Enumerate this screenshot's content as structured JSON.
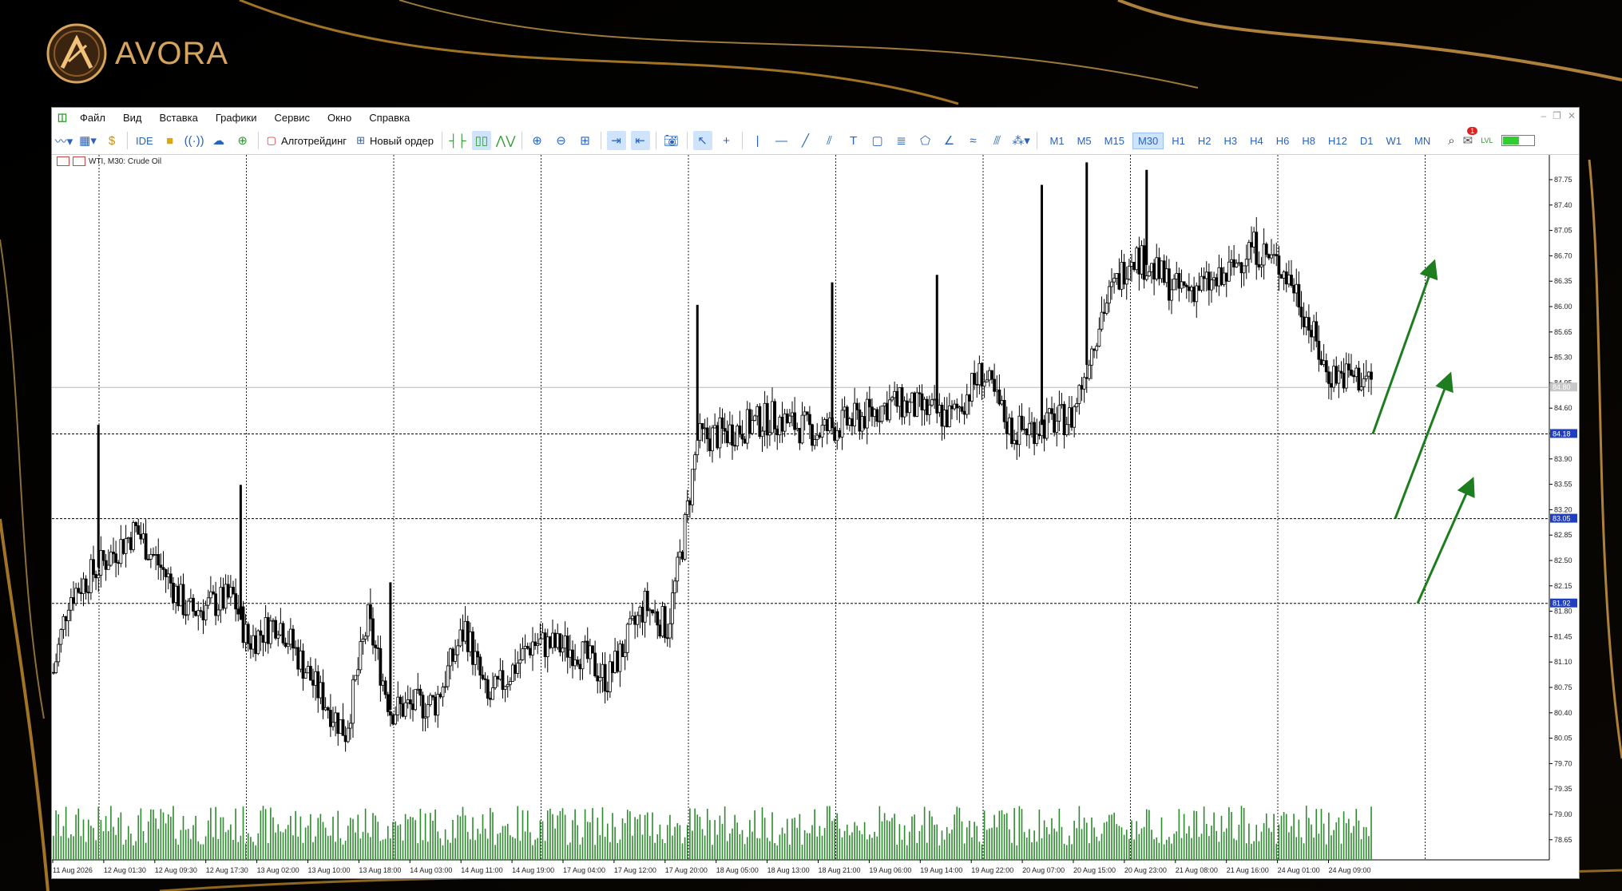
{
  "brand": {
    "name": "AVORA",
    "colors": {
      "gold": "#d6a45c"
    }
  },
  "menu": {
    "items": [
      "Файл",
      "Вид",
      "Вставка",
      "Графики",
      "Сервис",
      "Окно",
      "Справка"
    ]
  },
  "toolbar": {
    "ide_label": "IDE",
    "algotrading_label": "Алготрейдинг",
    "new_order_label": "Новый ордер",
    "timeframes": [
      "M1",
      "M5",
      "M15",
      "M30",
      "H1",
      "H2",
      "H3",
      "H4",
      "H6",
      "H8",
      "H12",
      "D1",
      "W1",
      "MN"
    ],
    "active_timeframe": "M30",
    "notification_count": "1",
    "lvl_label": "LVL"
  },
  "chart": {
    "symbol_info": "WTI, M30:  Crude Oil",
    "price_labels": [
      "87.75",
      "87.40",
      "87.05",
      "86.70",
      "86.35",
      "86.00",
      "85.65",
      "85.30",
      "84.95",
      "84.60",
      "84.25",
      "83.90",
      "83.55",
      "83.20",
      "82.85",
      "82.50",
      "82.15",
      "81.80",
      "81.45",
      "81.10",
      "80.75",
      "80.40",
      "80.05",
      "79.70",
      "79.35",
      "79.00",
      "78.65"
    ],
    "time_labels": [
      "11 Aug 2026",
      "12 Aug 01:30",
      "12 Aug 09:30",
      "12 Aug 17:30",
      "13 Aug 02:00",
      "13 Aug 10:00",
      "13 Aug 18:00",
      "14 Aug 03:00",
      "14 Aug 11:00",
      "14 Aug 19:00",
      "17 Aug 04:00",
      "17 Aug 12:00",
      "17 Aug 20:00",
      "18 Aug 05:00",
      "18 Aug 13:00",
      "18 Aug 21:00",
      "19 Aug 06:00",
      "19 Aug 14:00",
      "19 Aug 22:00",
      "20 Aug 07:00",
      "20 Aug 15:00",
      "20 Aug 23:00",
      "21 Aug 08:00",
      "21 Aug 16:00",
      "24 Aug 01:00",
      "24 Aug 09:00"
    ],
    "levels": [
      {
        "price": 84.18,
        "label": "84.18"
      },
      {
        "price": 83.05,
        "label": "83.05"
      },
      {
        "price": 81.92,
        "label": "81.92"
      }
    ],
    "current_price": {
      "price": 84.8,
      "label": "84.80"
    },
    "colors": {
      "level_tag": "#1f3fbf",
      "arrow": "#1e7d1e",
      "volume": "#2e8b2e",
      "candle": "#000000",
      "grid": "#000000"
    }
  },
  "chart_data": {
    "type": "candlestick",
    "symbol": "WTI",
    "timeframe": "M30",
    "ylim": [
      78.5,
      87.9
    ],
    "price_path_keypoints": [
      {
        "t": 0,
        "p": 81.0
      },
      {
        "t": 2,
        "p": 82.0
      },
      {
        "t": 8,
        "p": 82.6
      },
      {
        "t": 11,
        "p": 82.9
      },
      {
        "t": 15,
        "p": 82.3
      },
      {
        "t": 18,
        "p": 81.8
      },
      {
        "t": 24,
        "p": 82.0
      },
      {
        "t": 26,
        "p": 81.4
      },
      {
        "t": 30,
        "p": 81.7
      },
      {
        "t": 35,
        "p": 80.8
      },
      {
        "t": 39,
        "p": 80.2
      },
      {
        "t": 42,
        "p": 81.7
      },
      {
        "t": 45,
        "p": 80.5
      },
      {
        "t": 51,
        "p": 80.6
      },
      {
        "t": 55,
        "p": 81.6
      },
      {
        "t": 58,
        "p": 80.6
      },
      {
        "t": 64,
        "p": 81.4
      },
      {
        "t": 70,
        "p": 81.3
      },
      {
        "t": 74,
        "p": 80.9
      },
      {
        "t": 79,
        "p": 81.9
      },
      {
        "t": 82,
        "p": 81.6
      },
      {
        "t": 84,
        "p": 82.7
      },
      {
        "t": 86,
        "p": 84.1
      },
      {
        "t": 90,
        "p": 84.2
      },
      {
        "t": 96,
        "p": 84.4
      },
      {
        "t": 102,
        "p": 84.2
      },
      {
        "t": 108,
        "p": 84.4
      },
      {
        "t": 112,
        "p": 84.6
      },
      {
        "t": 120,
        "p": 84.4
      },
      {
        "t": 124,
        "p": 85.0
      },
      {
        "t": 128,
        "p": 84.2
      },
      {
        "t": 132,
        "p": 84.3
      },
      {
        "t": 136,
        "p": 84.4
      },
      {
        "t": 140,
        "p": 85.8
      },
      {
        "t": 144,
        "p": 86.6
      },
      {
        "t": 150,
        "p": 86.1
      },
      {
        "t": 156,
        "p": 86.2
      },
      {
        "t": 160,
        "p": 86.7
      },
      {
        "t": 164,
        "p": 86.4
      },
      {
        "t": 166,
        "p": 86.1
      },
      {
        "t": 170,
        "p": 85.0
      },
      {
        "t": 176,
        "p": 84.9
      }
    ],
    "spike_highs": [
      {
        "t": 6,
        "h": 84.3
      },
      {
        "t": 25,
        "h": 83.5
      },
      {
        "t": 45,
        "h": 82.2
      },
      {
        "t": 86,
        "h": 85.9
      },
      {
        "t": 104,
        "h": 86.2
      },
      {
        "t": 118,
        "h": 86.3
      },
      {
        "t": 132,
        "h": 87.5
      },
      {
        "t": 138,
        "h": 87.8
      },
      {
        "t": 146,
        "h": 87.7
      }
    ],
    "forecast_arrows": 3
  }
}
